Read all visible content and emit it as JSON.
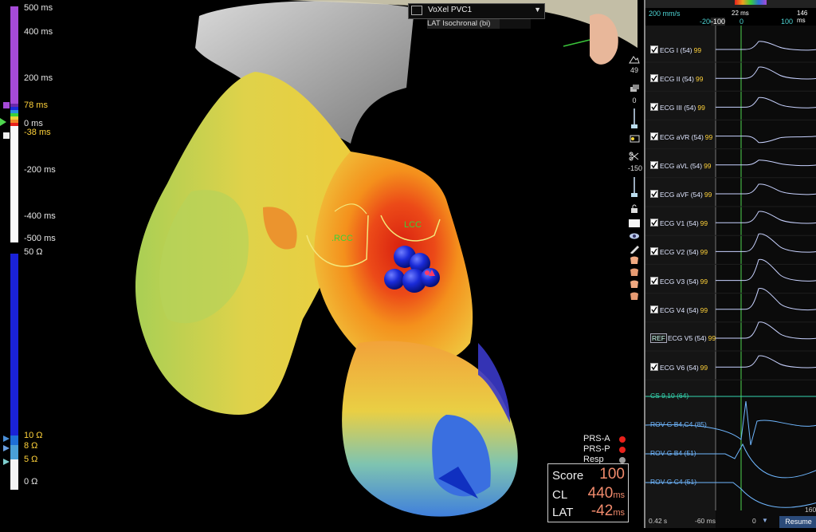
{
  "lat_scale": {
    "labels": {
      "top": "500 ms",
      "l400": "400 ms",
      "l200": "200 ms",
      "upper": "78 ms",
      "zero": "0 ms",
      "lower": "-38 ms",
      "lm200": "-200 ms",
      "lm400": "-400 ms",
      "bottom": "-500 ms"
    }
  },
  "impedance_scale": {
    "labels": {
      "top": "50 Ω",
      "l10": "10 Ω",
      "l8": "8 Ω",
      "l5": "5 Ω",
      "zero": "0 Ω"
    }
  },
  "map": {
    "selector_label": "VoXel PVC1",
    "map_type": "LAT Isochronal (bi)",
    "annotations": {
      "rcc": ".RCC",
      "lcc": "LCC"
    }
  },
  "toolbar": {
    "value_1": "49",
    "value_2": "0",
    "value_3": "-150"
  },
  "info_box": {
    "score_label": "Score",
    "score_value": "100",
    "cl_label": "CL",
    "cl_value": "440",
    "cl_unit": "ms",
    "lat_label": "LAT",
    "lat_value": "-42",
    "lat_unit": "ms"
  },
  "legend": [
    {
      "label": "PRS-A",
      "color": "#e8211b"
    },
    {
      "label": "PRS-P",
      "color": "#e8211b"
    },
    {
      "label": "Resp",
      "color": "#9a9a9a"
    }
  ],
  "ecg_panel": {
    "speed": "200 mm/s",
    "ticks": [
      "-200",
      "-100",
      "0",
      "100"
    ],
    "marker_left": "22 ms",
    "marker_right": "146 ms",
    "channels": [
      {
        "name": "ECG I (54)",
        "gain": "99",
        "checked": true
      },
      {
        "name": "ECG II (54)",
        "gain": "99",
        "checked": true
      },
      {
        "name": "ECG III (54)",
        "gain": "99",
        "checked": true
      },
      {
        "name": "ECG aVR (54)",
        "gain": "99",
        "checked": true
      },
      {
        "name": "ECG aVL (54)",
        "gain": "99",
        "checked": true
      },
      {
        "name": "ECG aVF (54)",
        "gain": "99",
        "checked": true
      },
      {
        "name": "ECG V1 (54)",
        "gain": "99",
        "checked": true
      },
      {
        "name": "ECG V2 (54)",
        "gain": "99",
        "checked": true
      },
      {
        "name": "ECG V3 (54)",
        "gain": "99",
        "checked": true
      },
      {
        "name": "ECG V4 (54)",
        "gain": "99",
        "checked": true
      },
      {
        "name": "ECG V5 (54)",
        "gain": "99",
        "ref": "REF"
      },
      {
        "name": "ECG V6 (54)",
        "gain": "99",
        "checked": true
      }
    ],
    "intracardiac": [
      {
        "name": "CS 9,10 (64)",
        "color": "#34d6b0"
      },
      {
        "name": "ROV G B4,C4 (85)",
        "color": "#6fb7ff"
      },
      {
        "name": "ROV G B4 (51)",
        "color": "#6fb7ff"
      },
      {
        "name": "ROV G C4 (51)",
        "color": "#6fb7ff"
      }
    ],
    "footer": {
      "time": "0.42 s",
      "offset": "-60 ms",
      "right_label": "160",
      "zero": "0",
      "resume": "Resume"
    }
  },
  "colors": {
    "accent": "#a64ad8",
    "zero_line": "#4fd64f"
  }
}
